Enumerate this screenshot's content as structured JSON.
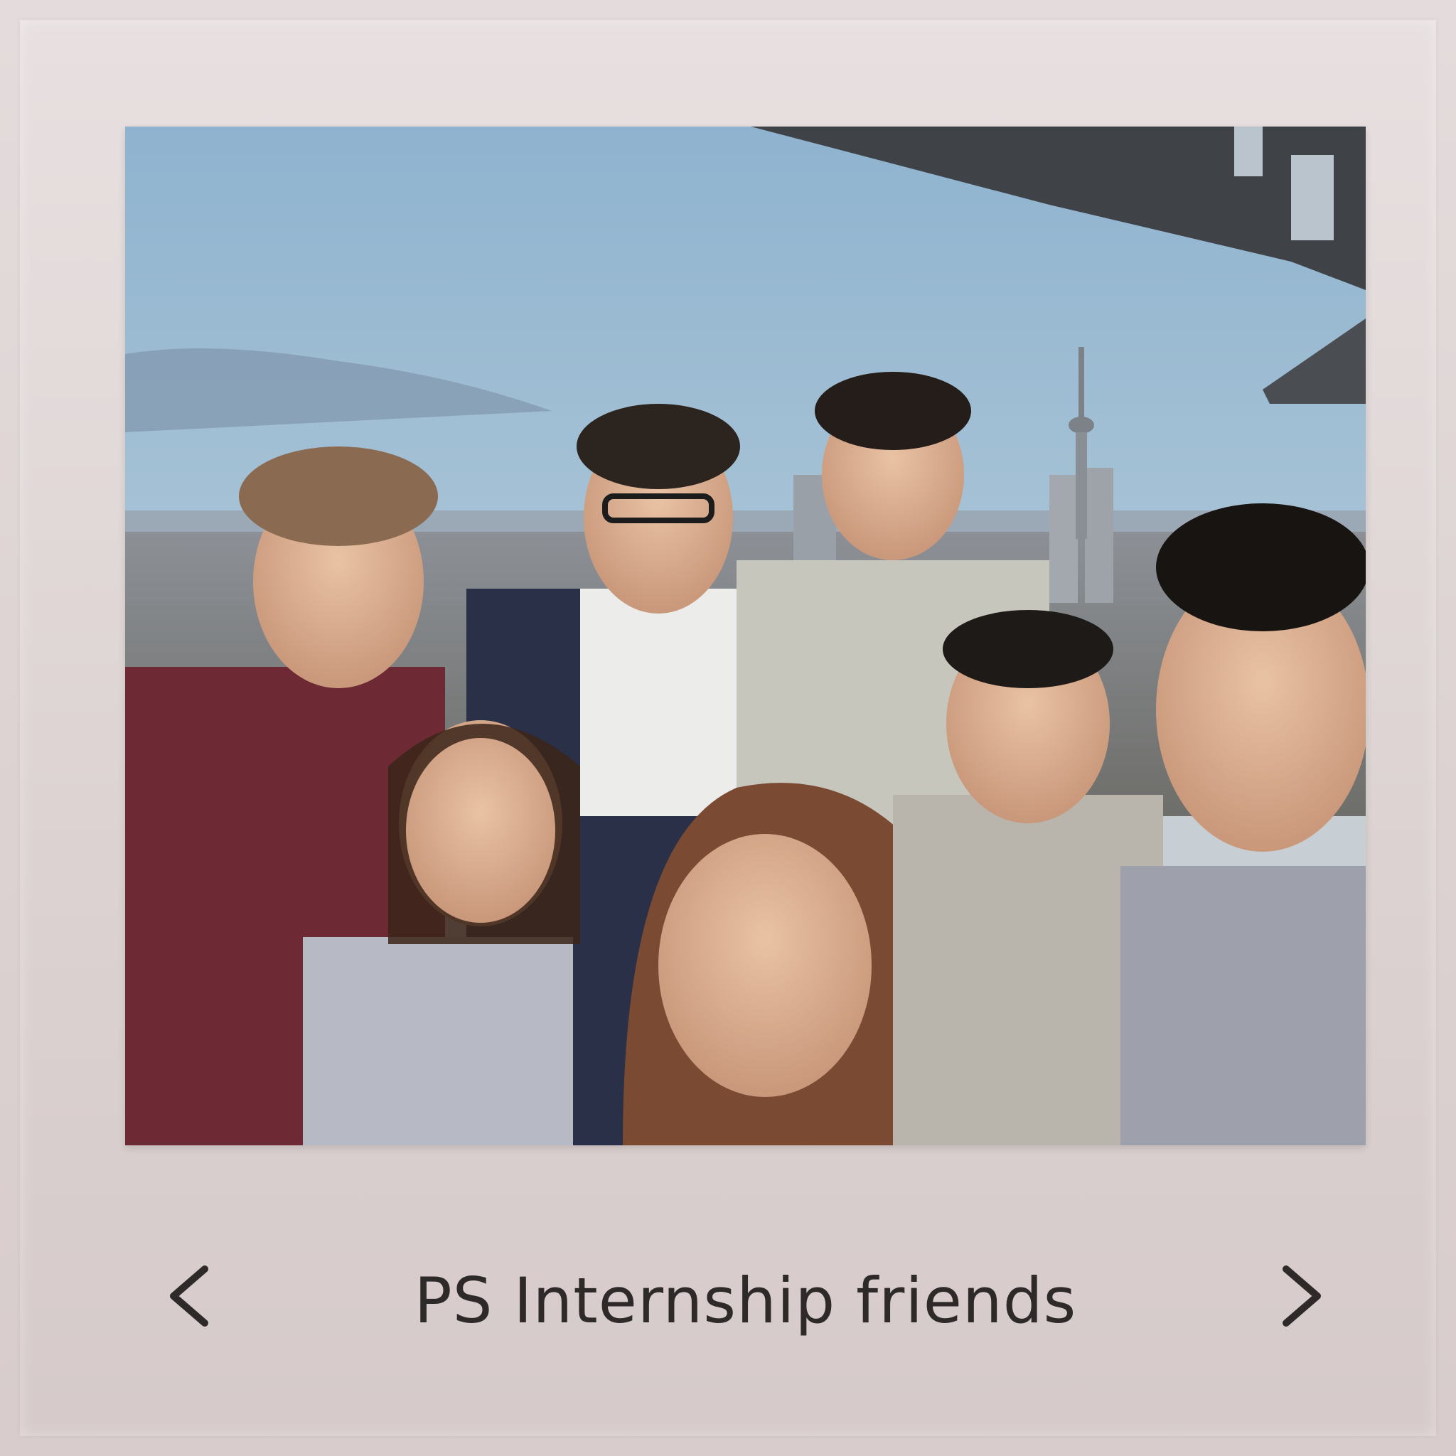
{
  "viewer": {
    "caption": "PS Internship friends",
    "prev_icon": "chevron-left-icon",
    "next_icon": "chevron-right-icon"
  },
  "photo": {
    "subject": "group-selfie-photo"
  },
  "colors": {
    "background": "#ddd3d3",
    "caption_text": "#2f2a2a",
    "chevron": "#2f2a2a"
  }
}
